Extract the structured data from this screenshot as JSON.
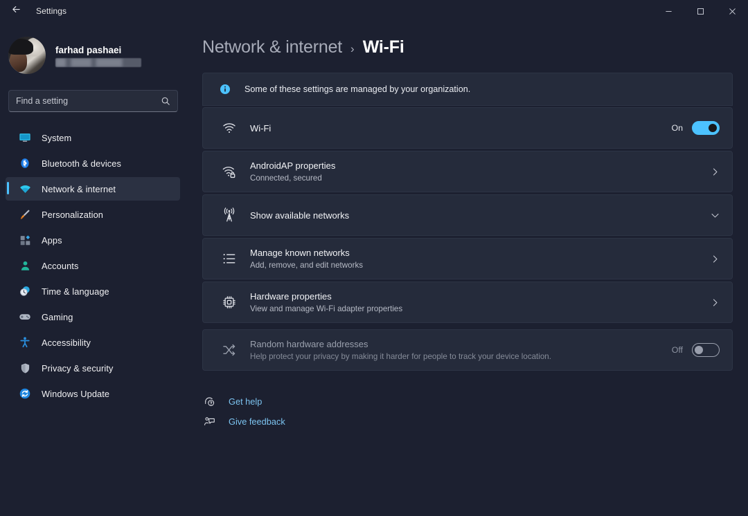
{
  "titlebar": {
    "back_label": "back-arrow",
    "title": "Settings",
    "minimize": "–",
    "maximize": "□",
    "close": "✕"
  },
  "sidebar": {
    "profile": {
      "name": "farhad pashaei",
      "email_redacted": ""
    },
    "search": {
      "placeholder": "Find a setting",
      "value": "",
      "icon": "search-icon"
    },
    "items": [
      {
        "label": "System",
        "icon": "monitor-icon",
        "selected": false
      },
      {
        "label": "Bluetooth & devices",
        "icon": "bluetooth-icon",
        "selected": false
      },
      {
        "label": "Network & internet",
        "icon": "wifi-icon",
        "selected": true
      },
      {
        "label": "Personalization",
        "icon": "paintbrush-icon",
        "selected": false
      },
      {
        "label": "Apps",
        "icon": "apps-grid-icon",
        "selected": false
      },
      {
        "label": "Accounts",
        "icon": "person-icon",
        "selected": false
      },
      {
        "label": "Time & language",
        "icon": "clock-icon",
        "selected": false
      },
      {
        "label": "Gaming",
        "icon": "gamepad-icon",
        "selected": false
      },
      {
        "label": "Accessibility",
        "icon": "accessibility-person-icon",
        "selected": false
      },
      {
        "label": "Privacy & security",
        "icon": "shield-icon",
        "selected": false
      },
      {
        "label": "Windows Update",
        "icon": "refresh-circle-icon",
        "selected": false
      }
    ]
  },
  "main": {
    "breadcrumb": {
      "parent": "Network & internet",
      "separator": "›",
      "current": "Wi-Fi"
    },
    "banner": {
      "icon": "info-icon",
      "text": "Some of these settings are managed by your organization."
    },
    "rows": [
      {
        "id": "wifi-toggle-row",
        "icon": "wifi-icon",
        "title": "Wi-Fi",
        "subtitle": "",
        "control": "toggle",
        "toggle_state": "On",
        "toggle_on": true,
        "disabled": false
      },
      {
        "id": "androidap-properties-row",
        "icon": "wifi-lock-icon",
        "title": "AndroidAP properties",
        "subtitle": "Connected, secured",
        "control": "chevron-right",
        "disabled": false
      },
      {
        "id": "show-available-networks-row",
        "icon": "broadcast-tower-icon",
        "title": "Show available networks",
        "subtitle": "",
        "control": "chevron-down",
        "disabled": false
      },
      {
        "id": "manage-known-networks-row",
        "icon": "list-icon",
        "title": "Manage known networks",
        "subtitle": "Add, remove, and edit networks",
        "control": "chevron-right",
        "disabled": false
      },
      {
        "id": "hardware-properties-row",
        "icon": "chip-icon",
        "title": "Hardware properties",
        "subtitle": "View and manage Wi-Fi adapter properties",
        "control": "chevron-right",
        "disabled": false
      },
      {
        "id": "random-hardware-addresses-row",
        "icon": "shuffle-icon",
        "title": "Random hardware addresses",
        "subtitle": "Help protect your privacy by making it harder for people to track your device location.",
        "control": "toggle",
        "toggle_state": "Off",
        "toggle_on": false,
        "disabled": true
      }
    ],
    "links": [
      {
        "label": "Get help",
        "icon": "help-icon"
      },
      {
        "label": "Give feedback",
        "icon": "feedback-icon"
      }
    ]
  },
  "colors": {
    "page_bg": "#1c2030",
    "card_bg": "#252b3b",
    "accent": "#4cc2ff",
    "link": "#7cc3f0",
    "text_primary": "#f2f3f6",
    "text_secondary": "#b6bac5"
  }
}
